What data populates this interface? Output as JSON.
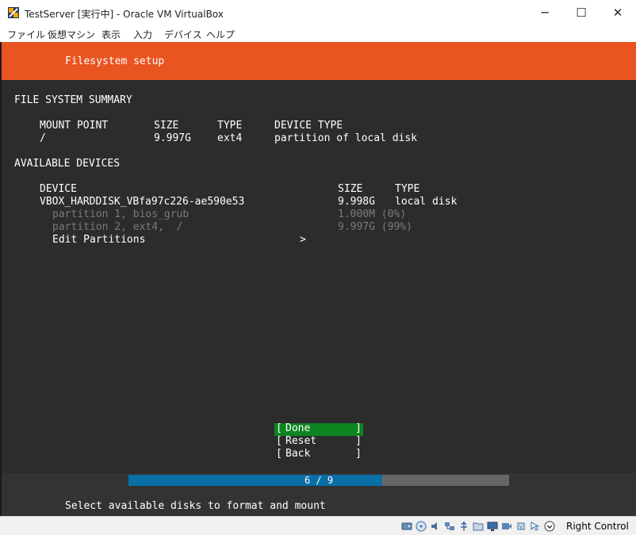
{
  "window": {
    "title": "TestServer [実行中] - Oracle VM VirtualBox",
    "minimize": "─",
    "maximize": "☐",
    "close": "✕"
  },
  "menu": [
    "ファイル",
    "仮想マシン",
    "表示",
    "入力",
    "デバイス",
    "ヘルプ"
  ],
  "installer": {
    "header": "Filesystem setup",
    "summary_heading": "FILE SYSTEM SUMMARY",
    "summary_columns": [
      "MOUNT POINT",
      "SIZE",
      "TYPE",
      "DEVICE TYPE"
    ],
    "summary_rows": [
      {
        "mount": "/",
        "size": "9.997G",
        "type": "ext4",
        "device_type": "partition of local disk"
      }
    ],
    "available_heading": "AVAILABLE DEVICES",
    "device_columns": [
      "DEVICE",
      "SIZE",
      "TYPE"
    ],
    "disk": {
      "name": "VBOX_HARDDISK_VBfa97c226-ae590e53",
      "size": "9.998G",
      "type": "local disk"
    },
    "partitions": [
      {
        "name": "partition 1, bios_grub",
        "size": "1.000M (0%)"
      },
      {
        "name": "partition 2, ext4,  /",
        "size": "9.997G (99%)"
      }
    ],
    "edit_partitions": "Edit Partitions",
    "edit_arrow": ">",
    "buttons": [
      {
        "label": "Done",
        "selected": true
      },
      {
        "label": "Reset",
        "selected": false
      },
      {
        "label": "Back",
        "selected": false
      }
    ],
    "bracket_left": "[",
    "bracket_right": "]",
    "progress": {
      "current": 6,
      "total": 9,
      "text": "6 / 9"
    },
    "hint": "Select available disks to format and mount"
  },
  "statusbar": {
    "icons": [
      "hard-disk-icon",
      "optical-drive-icon",
      "audio-icon",
      "network-icon",
      "usb-icon",
      "shared-folders-icon",
      "display-icon",
      "recording-icon",
      "cpu-icon",
      "mouse-integration-icon",
      "keyboard-icon"
    ],
    "host_key": "Right Control"
  },
  "colors": {
    "ubuntu_orange": "#e95420",
    "selected_button": "#0e8420",
    "progress_fill": "#0a6fa6",
    "terminal_bg": "#2c2c2c"
  }
}
